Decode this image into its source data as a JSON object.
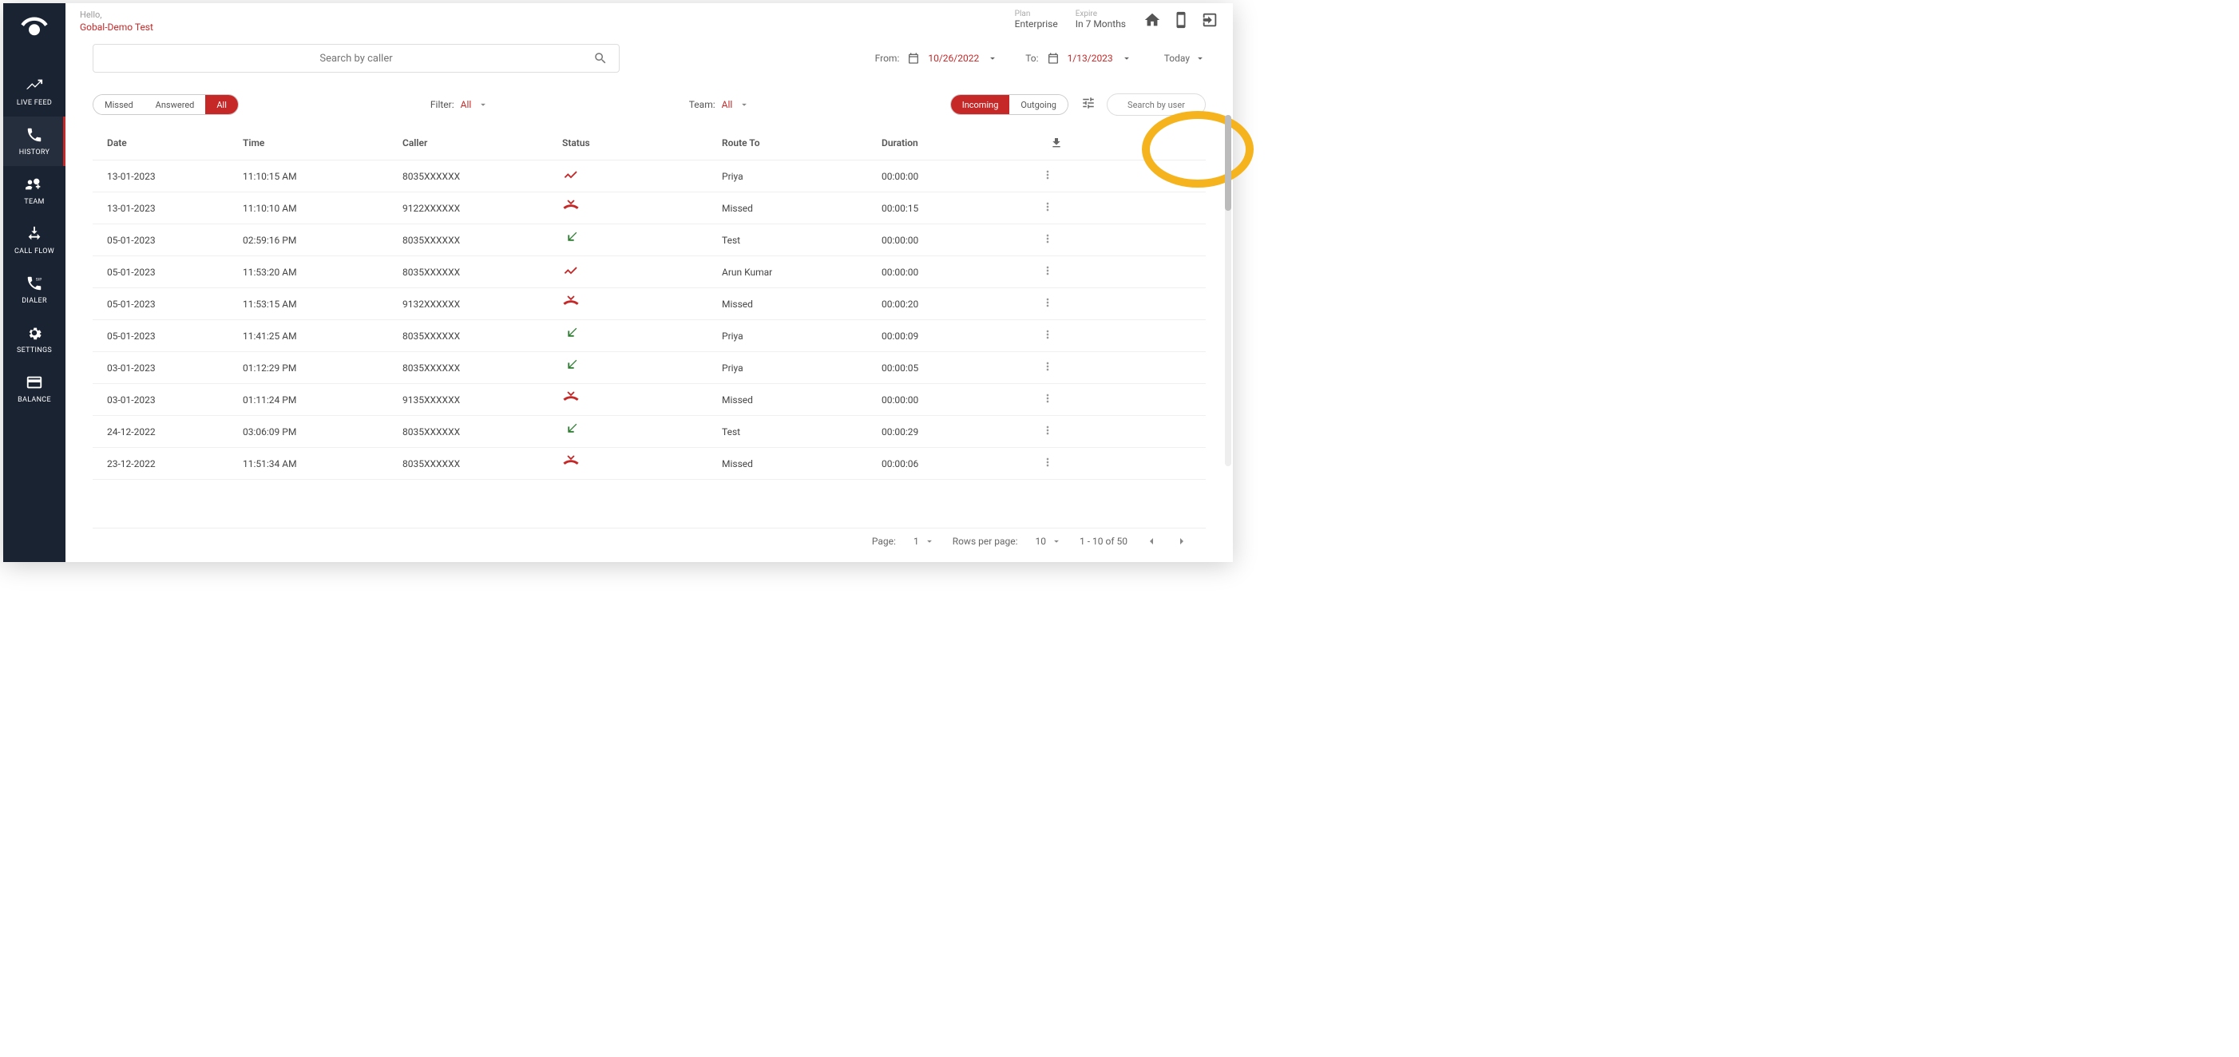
{
  "greeting": {
    "hello": "Hello,",
    "name": "Gobal-Demo Test"
  },
  "plan": {
    "label": "Plan",
    "value": "Enterprise"
  },
  "expire": {
    "label": "Expire",
    "value": "In 7 Months"
  },
  "search_caller_placeholder": "Search by caller",
  "from_label": "From:",
  "from_date": "10/26/2022",
  "to_label": "To:",
  "to_date": "1/13/2023",
  "today_label": "Today",
  "seg1": {
    "missed": "Missed",
    "answered": "Answered",
    "all": "All"
  },
  "filter": {
    "label": "Filter:",
    "value": "All"
  },
  "team": {
    "label": "Team:",
    "value": "All"
  },
  "seg2": {
    "incoming": "Incoming",
    "outgoing": "Outgoing"
  },
  "search_user_placeholder": "Search by user",
  "columns": {
    "date": "Date",
    "time": "Time",
    "caller": "Caller",
    "status": "Status",
    "route": "Route To",
    "duration": "Duration"
  },
  "rows": [
    {
      "date": "13-01-2023",
      "time": "11:10:15 AM",
      "caller": "8035XXXXXX",
      "status": "missed-arrow",
      "route": "Priya",
      "duration": "00:00:00"
    },
    {
      "date": "13-01-2023",
      "time": "11:10:10 AM",
      "caller": "9122XXXXXX",
      "status": "missed-hangup",
      "route": "Missed",
      "duration": "00:00:15"
    },
    {
      "date": "05-01-2023",
      "time": "02:59:16 PM",
      "caller": "8035XXXXXX",
      "status": "answered",
      "route": "Test",
      "duration": "00:00:00"
    },
    {
      "date": "05-01-2023",
      "time": "11:53:20 AM",
      "caller": "8035XXXXXX",
      "status": "missed-arrow",
      "route": "Arun Kumar",
      "duration": "00:00:00"
    },
    {
      "date": "05-01-2023",
      "time": "11:53:15 AM",
      "caller": "9132XXXXXX",
      "status": "missed-hangup",
      "route": "Missed",
      "duration": "00:00:20"
    },
    {
      "date": "05-01-2023",
      "time": "11:41:25 AM",
      "caller": "8035XXXXXX",
      "status": "answered",
      "route": "Priya",
      "duration": "00:00:09"
    },
    {
      "date": "03-01-2023",
      "time": "01:12:29 PM",
      "caller": "8035XXXXXX",
      "status": "answered",
      "route": "Priya",
      "duration": "00:00:05"
    },
    {
      "date": "03-01-2023",
      "time": "01:11:24 PM",
      "caller": "9135XXXXXX",
      "status": "missed-hangup",
      "route": "Missed",
      "duration": "00:00:00"
    },
    {
      "date": "24-12-2022",
      "time": "03:06:09 PM",
      "caller": "8035XXXXXX",
      "status": "answered",
      "route": "Test",
      "duration": "00:00:29"
    },
    {
      "date": "23-12-2022",
      "time": "11:51:34 AM",
      "caller": "8035XXXXXX",
      "status": "missed-hangup",
      "route": "Missed",
      "duration": "00:00:06"
    }
  ],
  "pager": {
    "page_label": "Page:",
    "page": "1",
    "rows_label": "Rows per page:",
    "rows": "10",
    "range": "1 - 10 of 50"
  },
  "nav": {
    "live_feed": "LIVE FEED",
    "history": "HISTORY",
    "team": "TEAM",
    "call_flow": "CALL FLOW",
    "dialer": "DIALER",
    "settings": "SETTINGS",
    "balance": "BALANCE"
  }
}
